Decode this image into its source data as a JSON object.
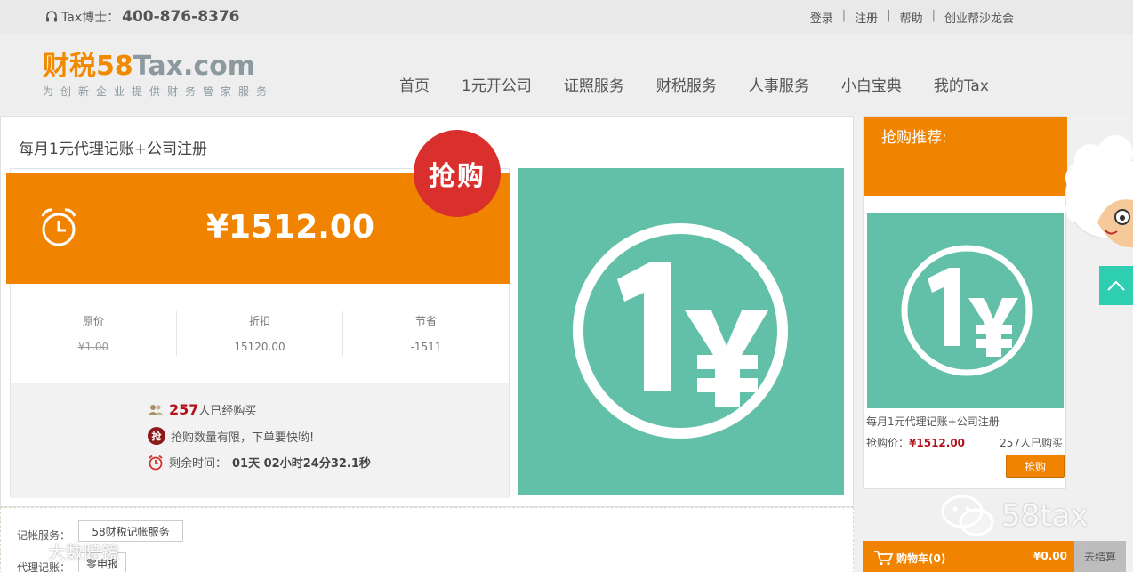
{
  "topbar": {
    "phone_label": "Tax博士：",
    "phone_number": "400-876-8376",
    "links": [
      "登录",
      "注册",
      "帮助",
      "创业帮沙龙会"
    ]
  },
  "logo": {
    "cn": "财税",
    "num": "58",
    "tax": "Tax",
    "dom": ".com",
    "slogan": "为创新企业提供财务管家服务"
  },
  "nav": [
    "首页",
    "1元开公司",
    "证照服务",
    "财税服务",
    "人事服务",
    "小白宝典",
    "我的Tax"
  ],
  "product": {
    "title": "每月1元代理记账+公司注册",
    "price": "¥1512.00",
    "badge": "抢购",
    "stats": [
      {
        "label": "原价",
        "value": "¥1.00"
      },
      {
        "label": "折扣",
        "value": "15120.00"
      },
      {
        "label": "节省",
        "value": "-1511"
      }
    ],
    "buyers_count": "257",
    "buyers_suffix": "人已经购买",
    "limit_text": "抢购数量有限，下单要快哟!",
    "qiang_icon_text": "抢",
    "countdown_label": "剩余时间：",
    "countdown_value": "01天 02小时24分32.1秒"
  },
  "services": {
    "r1_label": "记帐服务：",
    "r1_value": "58财税记帐服务",
    "r2_label": "代理记账：",
    "r2_value": "零申报"
  },
  "sidebar": {
    "heading": "抢购推荐:",
    "product_name": "每月1元代理记账+公司注册",
    "price_label": "抢购价：",
    "price_value": "¥1512.00",
    "sold": "257人已购买",
    "buy_button": "抢购"
  },
  "cart": {
    "label": "购物车(0)",
    "amount": "¥0.00",
    "checkout": "去结算"
  },
  "watermarks": {
    "wechat": "58tax",
    "left": "大数陪镜"
  },
  "colors": {
    "accent": "#f08300",
    "teal": "#62c0a8",
    "badge_red": "#d9302d",
    "price_red": "#b3121c"
  }
}
